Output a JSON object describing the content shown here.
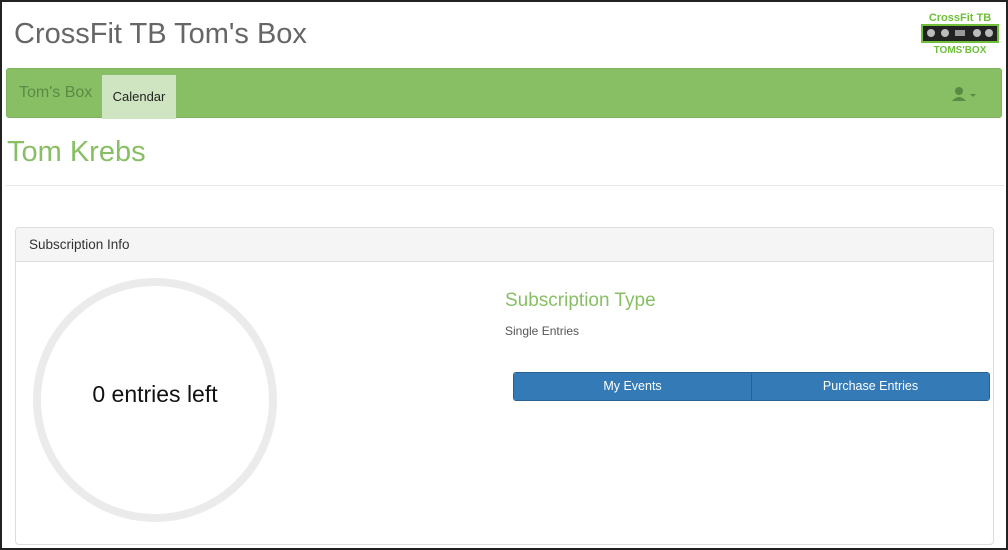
{
  "header": {
    "title": "CrossFit TB Tom's Box",
    "logo_text_top": "CrossFit TB",
    "logo_text_bottom": "TOMS'BOX"
  },
  "navbar": {
    "brand": "Tom's Box",
    "items": [
      {
        "label": "Calendar",
        "active": true
      }
    ],
    "user_icon": "user-icon",
    "caret_icon": "caret-down-icon"
  },
  "page": {
    "heading": "Tom Krebs"
  },
  "subscription_panel": {
    "title": "Subscription Info",
    "entries_left_text": "0 entries left",
    "entries_left_fraction": 0,
    "subscription_type_label": "Subscription Type",
    "subscription_type_value": "Single Entries",
    "buttons": {
      "my_events": "My Events",
      "purchase_entries": "Purchase Entries"
    }
  },
  "colors": {
    "brand_green": "#88bf65",
    "active_tab": "#cfe4c0",
    "primary_button": "#337ab7"
  }
}
